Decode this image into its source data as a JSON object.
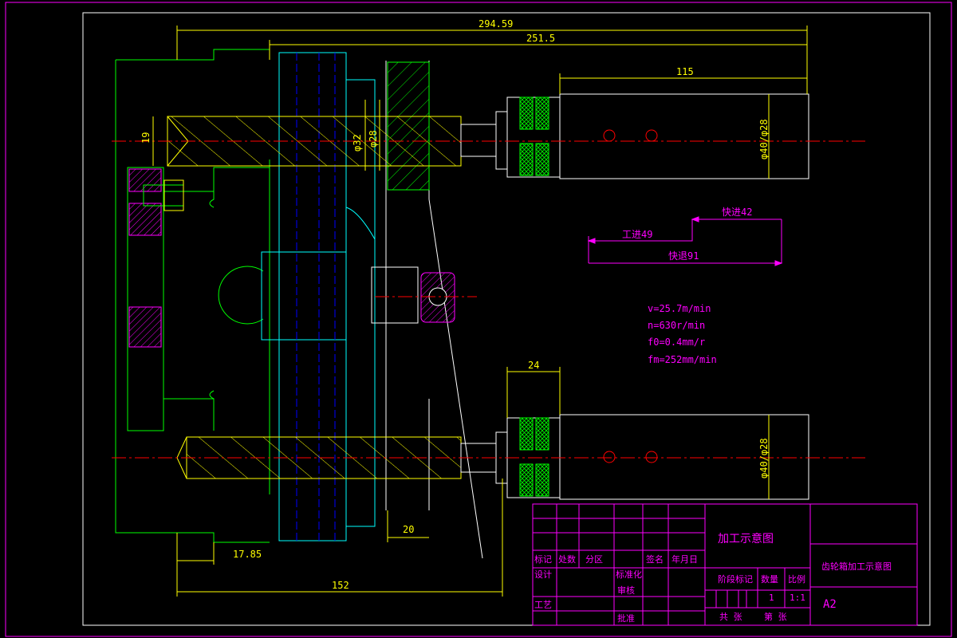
{
  "dimensions": {
    "total_length": "294.59",
    "length_2": "251.5",
    "length_3": "115",
    "height_19": "19",
    "dia_32": "φ32",
    "dia_28": "φ28",
    "dia_40_28_top": "φ40/φ28",
    "dia_40_28_bottom": "φ40/φ28",
    "width_24": "24",
    "width_20": "20",
    "offset_17_85": "17.85",
    "length_152": "152"
  },
  "feed_cycle": {
    "work_feed": "工进49",
    "fast_forward": "快进42",
    "fast_return": "快退91"
  },
  "cutting_params": {
    "v": "v=25.7m/min",
    "n": "n=630r/min",
    "f0": "f0=0.4mm/r",
    "fm": "fm=252mm/min"
  },
  "title_block": {
    "drawing_title": "加工示意图",
    "part_title": "齿轮箱加工示意图",
    "sheet_size": "A2",
    "quantity": "1",
    "scale": "1:1",
    "labels": {
      "mark": "标记",
      "count": "处数",
      "zone": "分区",
      "signature": "签名",
      "date": "年月日",
      "design": "设计",
      "standardize": "标准化",
      "review": "审核",
      "process": "工艺",
      "approve": "批准",
      "stage_mark": "阶段标记",
      "weight": "数量",
      "ratio": "比例",
      "total_sheets": "共 张",
      "sheet_no": "第 张"
    }
  },
  "colors": {
    "frame": "#ff00ff",
    "outline": "#ffffff",
    "part": "#00ff00",
    "tool": "#ffff00",
    "center": "#ff0000",
    "bore": "#0000ff",
    "hatch_cyan": "#00ffff"
  }
}
